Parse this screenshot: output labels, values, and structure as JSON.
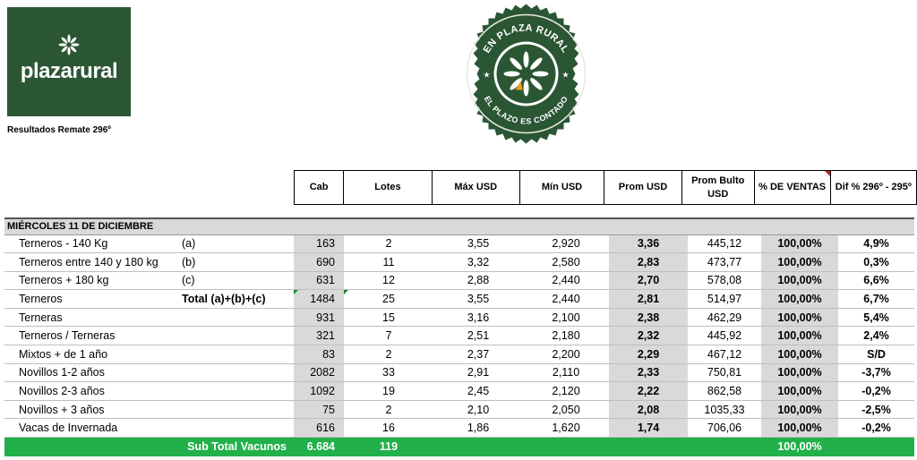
{
  "logo": {
    "brand": "plazarural",
    "icon": "flower-logo-icon",
    "color": "#2b5634"
  },
  "subtitle": "Resultados Remate 296º",
  "seal": {
    "top_text": "EN PLAZA RURAL",
    "bottom_text": "EL PLAZO ES CONTADO",
    "color": "#2b5634"
  },
  "columns": [
    "Cab",
    "Lotes",
    "Máx USD",
    "Mín USD",
    "Prom USD",
    "Prom Bulto USD",
    "% DE VENTAS",
    "Dif % 296º - 295º"
  ],
  "section_title": "MIÉRCOLES 11 DE DICIEMBRE",
  "rows": [
    {
      "name": "Terneros - 140 Kg",
      "ref": "(a)",
      "cab": "163",
      "lotes": "2",
      "max": "3,55",
      "min": "2,920",
      "prom": "3,36",
      "bulto": "445,12",
      "ventas": "100,00%",
      "dif": "4,9%"
    },
    {
      "name": "Terneros entre 140 y 180 kg",
      "ref": "(b)",
      "cab": "690",
      "lotes": "11",
      "max": "3,32",
      "min": "2,580",
      "prom": "2,83",
      "bulto": "473,77",
      "ventas": "100,00%",
      "dif": "0,3%"
    },
    {
      "name": "Terneros + 180 kg",
      "ref": "(c)",
      "cab": "631",
      "lotes": "12",
      "max": "2,88",
      "min": "2,440",
      "prom": "2,70",
      "bulto": "578,08",
      "ventas": "100,00%",
      "dif": "6,6%"
    },
    {
      "name": "Terneros",
      "ref": "Total (a)+(b)+(c)",
      "cab": "1484",
      "lotes": "25",
      "max": "3,55",
      "min": "2,440",
      "prom": "2,81",
      "bulto": "514,97",
      "ventas": "100,00%",
      "dif": "6,7%"
    },
    {
      "name": "Terneras",
      "ref": "",
      "cab": "931",
      "lotes": "15",
      "max": "3,16",
      "min": "2,100",
      "prom": "2,38",
      "bulto": "462,29",
      "ventas": "100,00%",
      "dif": "5,4%"
    },
    {
      "name": "Terneros / Terneras",
      "ref": "",
      "cab": "321",
      "lotes": "7",
      "max": "2,51",
      "min": "2,180",
      "prom": "2,32",
      "bulto": "445,92",
      "ventas": "100,00%",
      "dif": "2,4%"
    },
    {
      "name": "Mixtos + de 1 año",
      "ref": "",
      "cab": "83",
      "lotes": "2",
      "max": "2,37",
      "min": "2,200",
      "prom": "2,29",
      "bulto": "467,12",
      "ventas": "100,00%",
      "dif": "S/D"
    },
    {
      "name": "Novillos 1-2 años",
      "ref": "",
      "cab": "2082",
      "lotes": "33",
      "max": "2,91",
      "min": "2,110",
      "prom": "2,33",
      "bulto": "750,81",
      "ventas": "100,00%",
      "dif": "-3,7%"
    },
    {
      "name": "Novillos 2-3 años",
      "ref": "",
      "cab": "1092",
      "lotes": "19",
      "max": "2,45",
      "min": "2,120",
      "prom": "2,22",
      "bulto": "862,58",
      "ventas": "100,00%",
      "dif": "-0,2%"
    },
    {
      "name": "Novillos + 3 años",
      "ref": "",
      "cab": "75",
      "lotes": "2",
      "max": "2,10",
      "min": "2,050",
      "prom": "2,08",
      "bulto": "1035,33",
      "ventas": "100,00%",
      "dif": "-2,5%"
    },
    {
      "name": "Vacas de Invernada",
      "ref": "",
      "cab": "616",
      "lotes": "16",
      "max": "1,86",
      "min": "1,620",
      "prom": "1,74",
      "bulto": "706,06",
      "ventas": "100,00%",
      "dif": "-0,2%"
    }
  ],
  "subtotal": {
    "label": "Sub Total Vacunos",
    "cab": "6.684",
    "lotes": "119",
    "ventas": "100,00%",
    "color": "#22b04a"
  }
}
